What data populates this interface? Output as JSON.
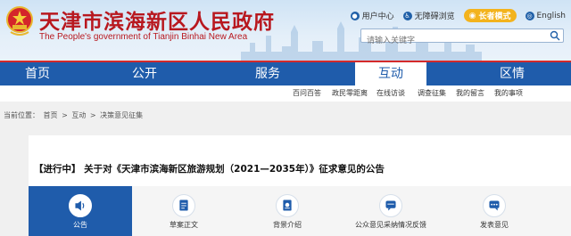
{
  "header": {
    "title": "天津市滨海新区人民政府",
    "subtitle": "The People's government of Tianjin Binhai New Area",
    "links": [
      {
        "label": "用户中心",
        "icon": "user-icon"
      },
      {
        "label": "无障碍浏览",
        "icon": "accessibility-icon"
      },
      {
        "label": "长者模式",
        "icon": "elder-mode-icon"
      },
      {
        "label": "English",
        "icon": "globe-icon"
      }
    ],
    "search": {
      "placeholder": "请输入关键字"
    }
  },
  "nav": {
    "items": [
      {
        "label": "首页"
      },
      {
        "label": "公开"
      },
      {
        "label": "服务"
      },
      {
        "label": "互动",
        "active": true
      },
      {
        "label": "区情"
      }
    ]
  },
  "subnav": {
    "items": [
      {
        "label": "百问百答"
      },
      {
        "label": "政民零距离"
      },
      {
        "label": "在线访谈"
      },
      {
        "label": "调查征集"
      },
      {
        "label": "我的留言"
      },
      {
        "label": "我的事项"
      }
    ]
  },
  "breadcrumb": {
    "prefix": "当前位置：",
    "items": [
      "首页",
      "互动",
      "决策意见征集"
    ],
    "separator": ">"
  },
  "notice": {
    "title": "【进行中】 关于对《天津市滨海新区旅游规划（2021—2035年）》征求意见的公告"
  },
  "tabs": [
    {
      "label": "公告",
      "icon": "speaker-icon",
      "active": true
    },
    {
      "label": "草案正文",
      "icon": "document-icon"
    },
    {
      "label": "背景介绍",
      "icon": "info-document-icon"
    },
    {
      "label": "公众意见采纳情况反馈",
      "icon": "feedback-icon"
    },
    {
      "label": "发表意见",
      "icon": "comment-icon"
    }
  ],
  "colors": {
    "brand_red": "#b8181f",
    "nav_blue": "#1f5cab",
    "elder_badge": "#f3b31d"
  }
}
